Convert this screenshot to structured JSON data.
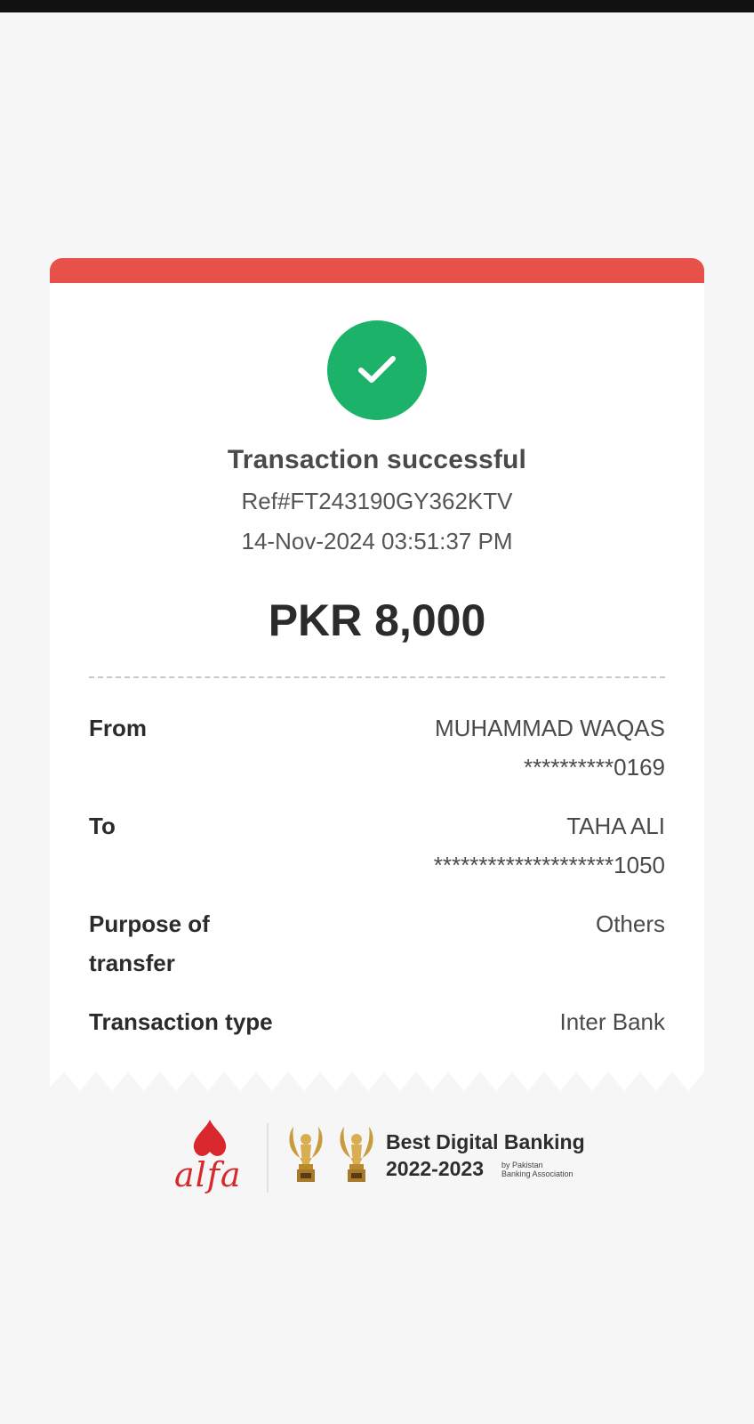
{
  "receipt": {
    "status_title": "Transaction successful",
    "reference": "Ref#FT243190GY362KTV",
    "datetime": "14-Nov-2024 03:51:37 PM",
    "amount": "PKR 8,000",
    "details": [
      {
        "label": "From",
        "value": "MUHAMMAD WAQAS",
        "sub_value": "**********0169"
      },
      {
        "label": "To",
        "value": "TAHA ALI",
        "sub_value": "********************1050"
      },
      {
        "label": "Purpose of transfer",
        "value": "Others"
      },
      {
        "label": "Transaction type",
        "value": "Inter Bank"
      }
    ]
  },
  "footer": {
    "brand": "alfa",
    "award_title": "Best Digital Banking",
    "award_years": "2022-2023",
    "award_by_line1": "by Pakistan",
    "award_by_line2": "Banking Association"
  },
  "icons": {
    "success": "check-circle-icon",
    "brand": "alfa-logo-icon",
    "award": "trophy-icon"
  },
  "colors": {
    "accent_red": "#e8504a",
    "success_green": "#1db26a",
    "brand_red": "#d8282d",
    "background": "#f6f6f6"
  }
}
